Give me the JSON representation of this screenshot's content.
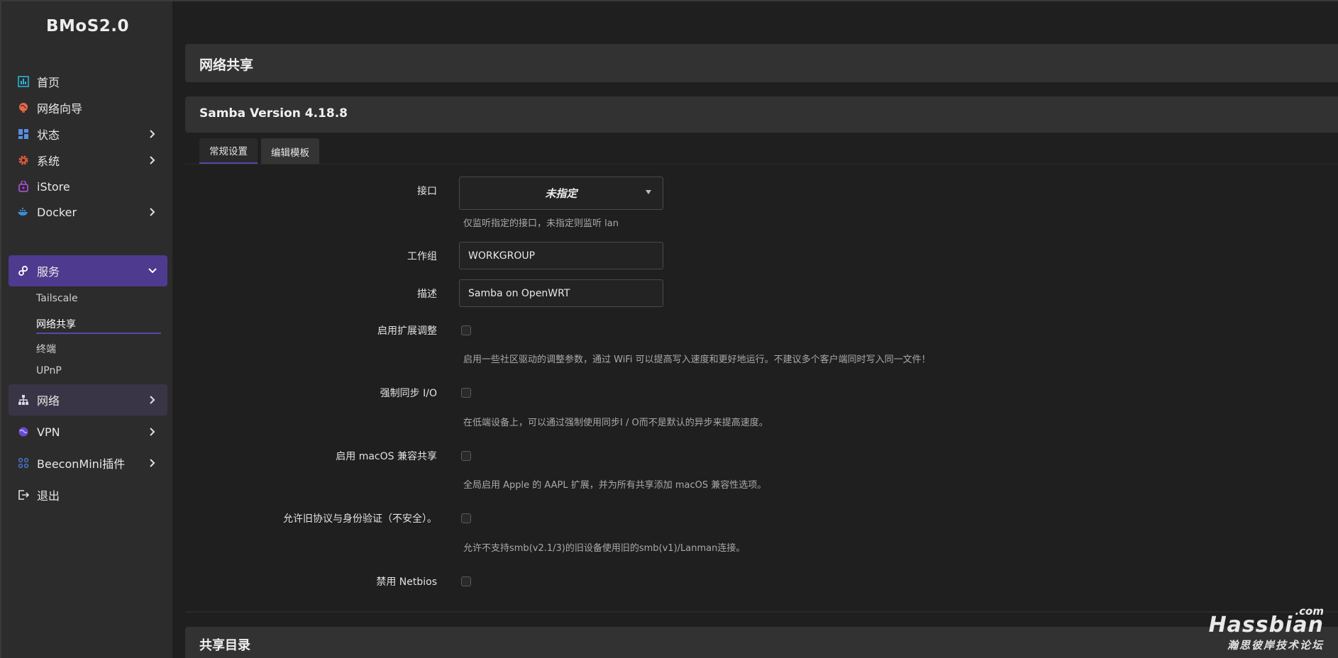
{
  "brand": "BMoS2.0",
  "sidebar": {
    "items": [
      {
        "label": "首页",
        "icon": "dashboard-icon"
      },
      {
        "label": "网络向导",
        "icon": "globe-wizard-icon"
      },
      {
        "label": "状态",
        "icon": "status-grid-icon"
      },
      {
        "label": "系统",
        "icon": "gear-icon"
      },
      {
        "label": "iStore",
        "icon": "store-icon"
      },
      {
        "label": "Docker",
        "icon": "docker-icon"
      },
      {
        "label": "服务",
        "icon": "services-icon"
      },
      {
        "label": "网络",
        "icon": "network-tree-icon"
      },
      {
        "label": "VPN",
        "icon": "vpn-globe-icon"
      },
      {
        "label": "BeeconMini插件",
        "icon": "plugin-grid-icon"
      },
      {
        "label": "退出",
        "icon": "logout-icon"
      }
    ],
    "subitems": [
      "Tailscale",
      "网络共享",
      "终端",
      "UPnP"
    ]
  },
  "page": {
    "title": "网络共享",
    "section_title": "Samba Version 4.18.8",
    "tabs": [
      "常规设置",
      "编辑模板"
    ],
    "bottom_section_title": "共享目录"
  },
  "form": {
    "interface": {
      "label": "接口",
      "value": "未指定",
      "help": "仅监听指定的接口，未指定则监听 lan"
    },
    "workgroup": {
      "label": "工作组",
      "value": "WORKGROUP"
    },
    "description": {
      "label": "描述",
      "value": "Samba on OpenWRT"
    },
    "tweaks": {
      "label": "启用扩展调整",
      "help": "启用一些社区驱动的调整参数，通过 WiFi 可以提高写入速度和更好地运行。不建议多个客户端同时写入同一文件！"
    },
    "sync_io": {
      "label": "强制同步 I/O",
      "help": "在低端设备上，可以通过强制使用同步I / O而不是默认的异步来提高速度。"
    },
    "macos": {
      "label": "启用 macOS 兼容共享",
      "help": "全局启用 Apple 的 AAPL 扩展，并为所有共享添加 macOS 兼容性选项。"
    },
    "legacy": {
      "label": "允许旧协议与身份验证（不安全）。",
      "help": "允许不支持smb(v2.1/3)的旧设备使用旧的smb(v1)/Lanman连接。"
    },
    "netbios": {
      "label": "禁用 Netbios"
    }
  },
  "watermark": {
    "main": "Hassbian",
    "dotcom": ".com",
    "sub": "瀚思彼岸技术论坛"
  },
  "colors": {
    "accent": "#4e3a8e",
    "sidebar_bg": "#2c2c2c",
    "panel_bg": "#323232",
    "page_bg": "#1f1f1f"
  }
}
